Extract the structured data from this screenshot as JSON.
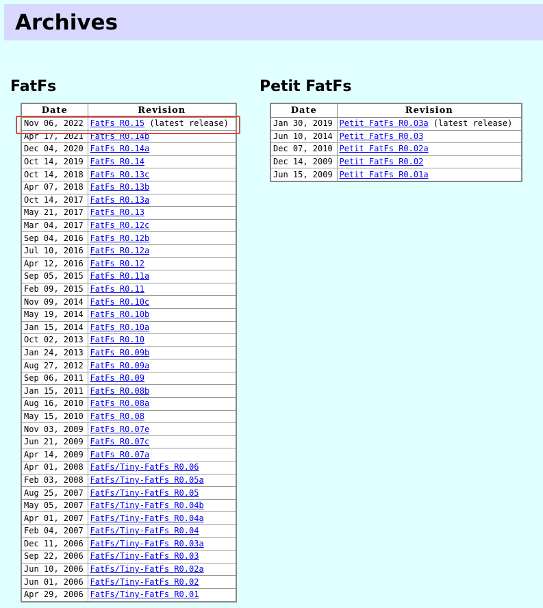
{
  "page": {
    "title": "Archives"
  },
  "fatfs": {
    "heading": "FatFs",
    "columns": [
      "Date",
      "Revision"
    ],
    "rows": [
      {
        "date": "Nov 06, 2022",
        "link": "FatFs R0.15",
        "note": " (latest release)"
      },
      {
        "date": "Apr 17, 2021",
        "link": "FatFs R0.14b",
        "note": ""
      },
      {
        "date": "Dec 04, 2020",
        "link": "FatFs R0.14a",
        "note": ""
      },
      {
        "date": "Oct 14, 2019",
        "link": "FatFs R0.14",
        "note": ""
      },
      {
        "date": "Oct 14, 2018",
        "link": "FatFs R0.13c",
        "note": ""
      },
      {
        "date": "Apr 07, 2018",
        "link": "FatFs R0.13b",
        "note": ""
      },
      {
        "date": "Oct 14, 2017",
        "link": "FatFs R0.13a",
        "note": ""
      },
      {
        "date": "May 21, 2017",
        "link": "FatFs R0.13",
        "note": ""
      },
      {
        "date": "Mar 04, 2017",
        "link": "FatFs R0.12c",
        "note": ""
      },
      {
        "date": "Sep 04, 2016",
        "link": "FatFs R0.12b",
        "note": ""
      },
      {
        "date": "Jul 10, 2016",
        "link": "FatFs R0.12a",
        "note": ""
      },
      {
        "date": "Apr 12, 2016",
        "link": "FatFs R0.12",
        "note": ""
      },
      {
        "date": "Sep 05, 2015",
        "link": "FatFs R0.11a",
        "note": ""
      },
      {
        "date": "Feb 09, 2015",
        "link": "FatFs R0.11",
        "note": ""
      },
      {
        "date": "Nov 09, 2014",
        "link": "FatFs R0.10c",
        "note": ""
      },
      {
        "date": "May 19, 2014",
        "link": "FatFs R0.10b",
        "note": ""
      },
      {
        "date": "Jan 15, 2014",
        "link": "FatFs R0.10a",
        "note": ""
      },
      {
        "date": "Oct 02, 2013",
        "link": "FatFs R0.10",
        "note": ""
      },
      {
        "date": "Jan 24, 2013",
        "link": "FatFs R0.09b",
        "note": ""
      },
      {
        "date": "Aug 27, 2012",
        "link": "FatFs R0.09a",
        "note": ""
      },
      {
        "date": "Sep 06, 2011",
        "link": "FatFs R0.09",
        "note": ""
      },
      {
        "date": "Jan 15, 2011",
        "link": "FatFs R0.08b",
        "note": ""
      },
      {
        "date": "Aug 16, 2010",
        "link": "FatFs R0.08a",
        "note": ""
      },
      {
        "date": "May 15, 2010",
        "link": "FatFs R0.08",
        "note": ""
      },
      {
        "date": "Nov 03, 2009",
        "link": "FatFs R0.07e",
        "note": ""
      },
      {
        "date": "Jun 21, 2009",
        "link": "FatFs R0.07c",
        "note": ""
      },
      {
        "date": "Apr 14, 2009",
        "link": "FatFs R0.07a",
        "note": ""
      },
      {
        "date": "Apr 01, 2008",
        "link": "FatFs/Tiny-FatFs R0.06",
        "note": ""
      },
      {
        "date": "Feb 03, 2008",
        "link": "FatFs/Tiny-FatFs R0.05a",
        "note": ""
      },
      {
        "date": "Aug 25, 2007",
        "link": "FatFs/Tiny-FatFs R0.05",
        "note": ""
      },
      {
        "date": "May 05, 2007",
        "link": "FatFs/Tiny-FatFs R0.04b",
        "note": ""
      },
      {
        "date": "Apr 01, 2007",
        "link": "FatFs/Tiny-FatFs R0.04a",
        "note": ""
      },
      {
        "date": "Feb 04, 2007",
        "link": "FatFs/Tiny-FatFs R0.04",
        "note": ""
      },
      {
        "date": "Dec 11, 2006",
        "link": "FatFs/Tiny-FatFs R0.03a",
        "note": ""
      },
      {
        "date": "Sep 22, 2006",
        "link": "FatFs/Tiny-FatFs R0.03",
        "note": ""
      },
      {
        "date": "Jun 10, 2006",
        "link": "FatFs/Tiny-FatFs R0.02a",
        "note": ""
      },
      {
        "date": "Jun 01, 2006",
        "link": "FatFs/Tiny-FatFs R0.02",
        "note": ""
      },
      {
        "date": "Apr 29, 2006",
        "link": "FatFs/Tiny-FatFs R0.01",
        "note": ""
      }
    ]
  },
  "petit": {
    "heading": "Petit FatFs",
    "columns": [
      "Date",
      "Revision"
    ],
    "rows": [
      {
        "date": "Jan 30, 2019",
        "link": "Petit FatFs R0.03a",
        "note": " (latest release)"
      },
      {
        "date": "Jun 10, 2014",
        "link": "Petit FatFs R0.03",
        "note": ""
      },
      {
        "date": "Dec 07, 2010",
        "link": "Petit FatFs R0.02a",
        "note": ""
      },
      {
        "date": "Dec 14, 2009",
        "link": "Petit FatFs R0.02",
        "note": ""
      },
      {
        "date": "Jun 15, 2009",
        "link": "Petit FatFs R0.01a",
        "note": ""
      }
    ]
  },
  "colors": {
    "background": "#e0ffff",
    "header_band": "#d8d8ff",
    "link": "#0000ee",
    "highlight": "#e0473c"
  }
}
